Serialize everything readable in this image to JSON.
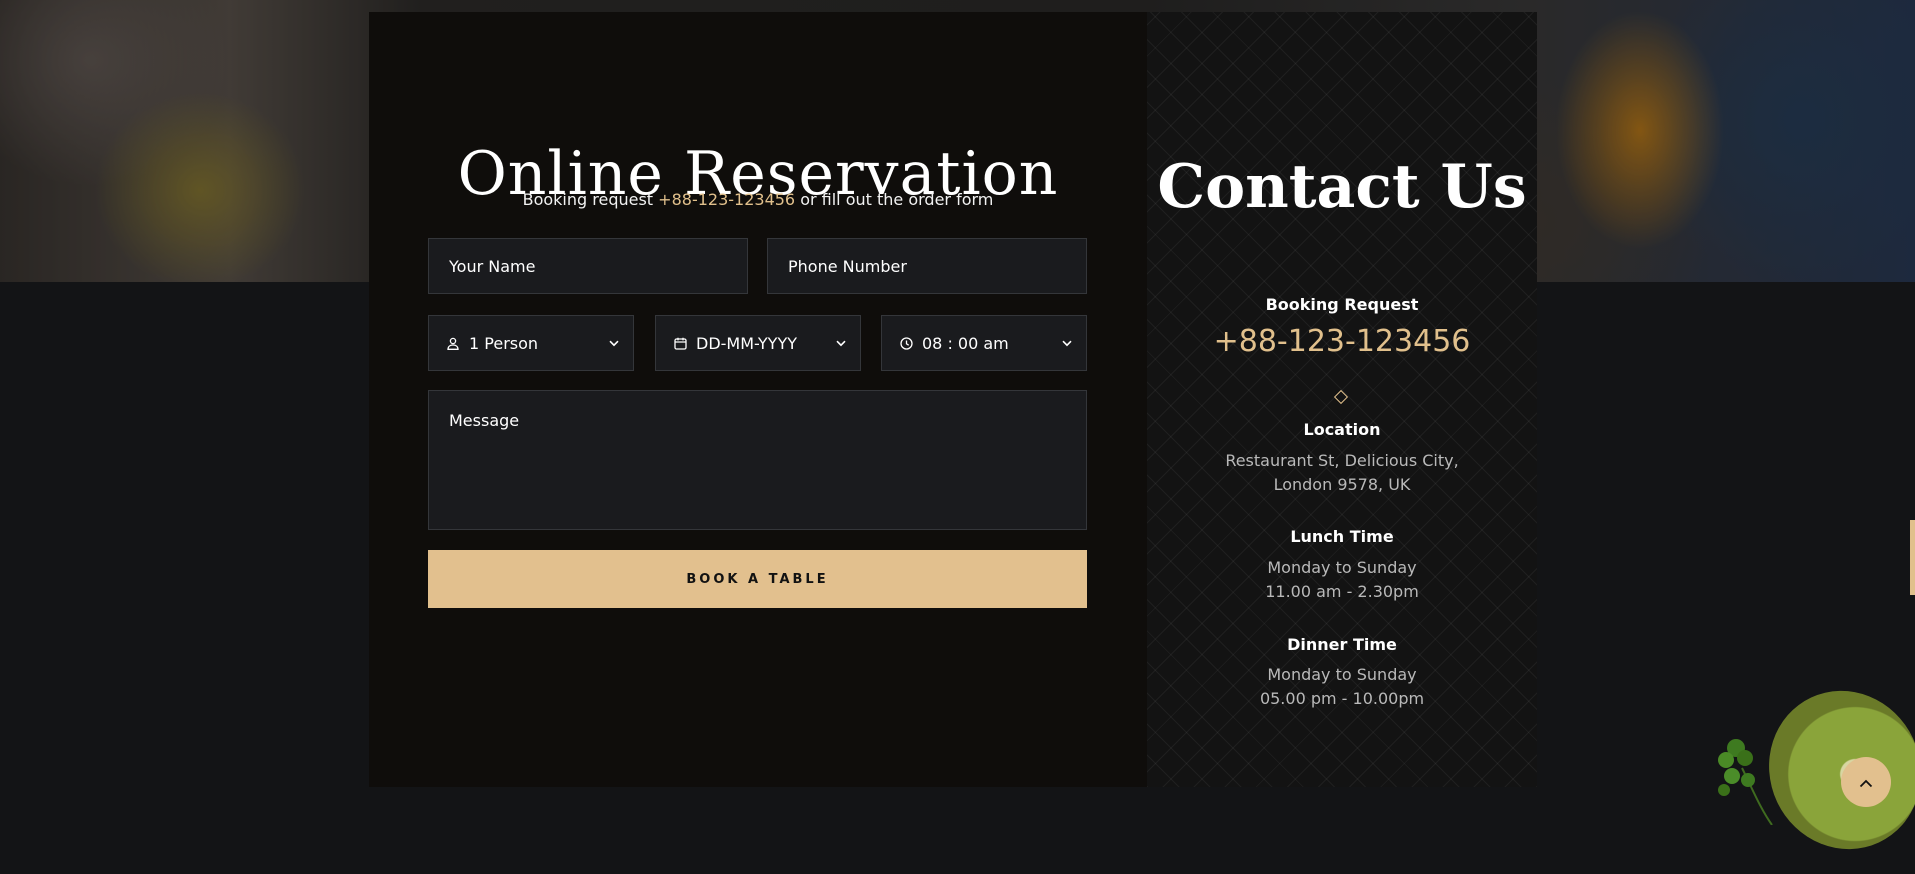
{
  "reservation": {
    "title": "Online Reservation",
    "subtitle_prefix": "Booking request ",
    "subtitle_phone": "+88-123-123456",
    "subtitle_suffix": " or fill out the order form",
    "name_placeholder": "Your Name",
    "phone_placeholder": "Phone Number",
    "person_value": "1 Person",
    "date_value": "DD-MM-YYYY",
    "time_value": "08 : 00 am",
    "message_placeholder": "Message",
    "book_button": "BOOK A TABLE"
  },
  "contact": {
    "title": "Contact Us",
    "booking_label": "Booking Request",
    "booking_phone": "+88-123-123456",
    "location_label": "Location",
    "location_line1": "Restaurant St, Delicious City,",
    "location_line2": "London 9578, UK",
    "lunch_label": "Lunch Time",
    "lunch_days": "Monday to Sunday",
    "lunch_hours": "11.00 am - 2.30pm",
    "dinner_label": "Dinner Time",
    "dinner_days": "Monday to Sunday",
    "dinner_hours": "05.00 pm - 10.00pm"
  },
  "icons": {
    "person": "user-icon",
    "date": "calendar-icon",
    "time": "clock-icon",
    "dropdown": "chevron-down-icon",
    "scroll_top": "chevron-up-icon"
  },
  "colors": {
    "accent": "#e1c08c",
    "panel": "#0f0d0b",
    "page": "#131416"
  }
}
